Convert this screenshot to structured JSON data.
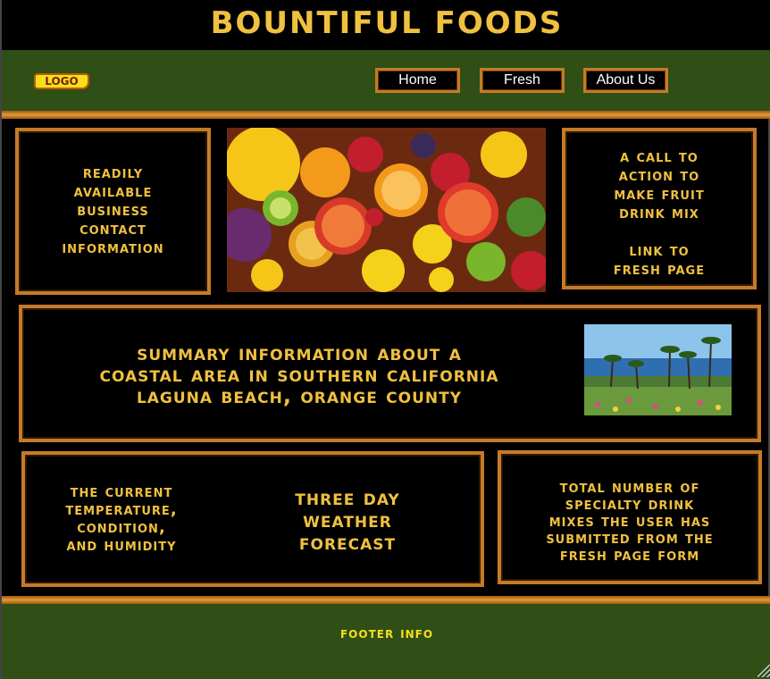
{
  "header": {
    "title": "Bountiful Foods"
  },
  "nav": {
    "logo_label": "LOGO",
    "items": [
      {
        "label": "Home"
      },
      {
        "label": "Fresh"
      },
      {
        "label": "About Us"
      }
    ]
  },
  "panels": {
    "contact": {
      "lines": [
        "Readily",
        "Available",
        "Business",
        "Contact",
        "Information"
      ]
    },
    "call_to_action": {
      "lines": [
        "A call to",
        "action to",
        "make fruit",
        "drink mix"
      ],
      "link_lines": [
        "Link to",
        "Fresh page"
      ]
    },
    "summary": {
      "lines": [
        "Summary information about a",
        "coastal area in southern California",
        "Laguna Beach, Orange County"
      ]
    },
    "weather": {
      "current_lines": [
        "The current",
        "temperature,",
        "condition,",
        "and humidity"
      ],
      "forecast_lines": [
        "Three Day",
        "weather",
        "forecast"
      ]
    },
    "drink_count": {
      "lines": [
        "Total number of",
        "specialty drink",
        "mixes the user has",
        "submitted from the",
        "fresh page form"
      ]
    }
  },
  "images": {
    "fruit": "fruit-photo",
    "beach": "beach-photo"
  },
  "footer": {
    "text": "Footer Info"
  },
  "colors": {
    "accent_text": "#f0c040",
    "border": "#c77a26",
    "nav_bg": "#2f4f16",
    "footer_text": "#f5df1f"
  }
}
